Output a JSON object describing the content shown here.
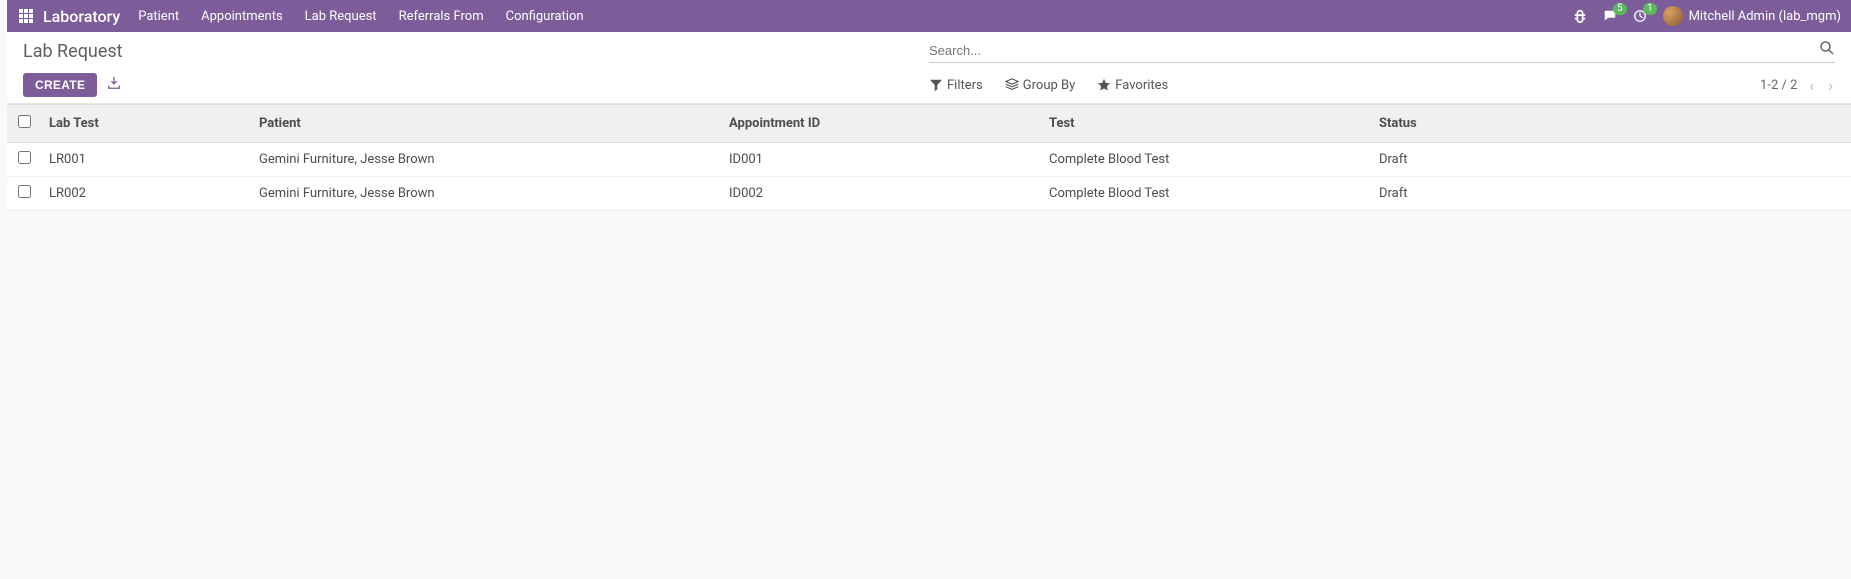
{
  "nav": {
    "brand": "Laboratory",
    "items": [
      "Patient",
      "Appointments",
      "Lab Request",
      "Referrals From",
      "Configuration"
    ],
    "messages_badge": "5",
    "activities_badge": "1",
    "username": "Mitchell Admin (lab_mgm)"
  },
  "cp": {
    "title": "Lab Request",
    "search_placeholder": "Search...",
    "create_label": "CREATE",
    "filters_label": "Filters",
    "groupby_label": "Group By",
    "favorites_label": "Favorites",
    "pager": "1-2 / 2"
  },
  "table": {
    "headers": {
      "labtest": "Lab Test",
      "patient": "Patient",
      "appointment": "Appointment ID",
      "test": "Test",
      "status": "Status"
    },
    "rows": [
      {
        "labtest": "LR001",
        "patient": "Gemini Furniture, Jesse Brown",
        "appointment": "ID001",
        "test": "Complete Blood Test",
        "status": "Draft"
      },
      {
        "labtest": "LR002",
        "patient": "Gemini Furniture, Jesse Brown",
        "appointment": "ID002",
        "test": "Complete Blood Test",
        "status": "Draft"
      }
    ]
  }
}
